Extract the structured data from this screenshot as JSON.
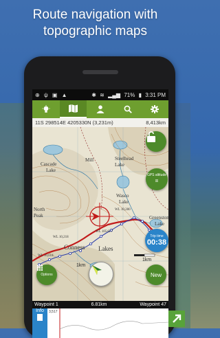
{
  "headline": {
    "line1": "Route navigation with",
    "line2": "topographic maps"
  },
  "statusbar": {
    "left_icons": [
      "location-icon",
      "usb-icon",
      "image-icon",
      "warning-icon"
    ],
    "battery": "71%",
    "time": "3:31 PM"
  },
  "toolbar": {
    "items": [
      {
        "name": "lightbulb",
        "glyph": "💡"
      },
      {
        "name": "map",
        "glyph": "🗺"
      },
      {
        "name": "person",
        "glyph": "👤"
      },
      {
        "name": "search",
        "glyph": "🔍"
      },
      {
        "name": "settings",
        "glyph": "⚙"
      }
    ],
    "active_index": 1,
    "color": "#6e9f2f"
  },
  "coords": {
    "position": "11S 298514E 4205330N (3,231m)",
    "distance": "8,413km"
  },
  "map": {
    "labels": {
      "steelhead": "Steelhead",
      "lake1": "Lake",
      "cascade": "Cascade",
      "lake2": "Lake",
      "wasco": "Wasco",
      "lake3": "Lake",
      "north": "North",
      "peak": "Peak",
      "greenstone": "Greenstone",
      "lake4": "Lake",
      "conness": "Conness",
      "lakes": "Lakes",
      "elev1": "WL 10543.7",
      "elev2": "WL 10,614",
      "elev3": "WL 10,280",
      "elev4": "WL 10,218",
      "mill": "Mill"
    },
    "scale": "1km",
    "scale2": "1km"
  },
  "buttons": {
    "gps_altitude": "GPS altitude",
    "gps_value": "=",
    "trip_time": "Trip time",
    "trip_value": "00:38",
    "new_label": "New",
    "options_label": "Options",
    "lock_glyph": "🔓"
  },
  "waypoints": {
    "from": "Waypoint 1",
    "distance": "6.81km",
    "to": "Waypoint 47"
  },
  "profile": {
    "info_label": "Info",
    "elevation": "3,517"
  },
  "colors": {
    "route": "#c21a1a",
    "track_blue": "#2d3ea8",
    "accent_green": "#4d8a2a",
    "accent_blue": "#2a84c9"
  }
}
